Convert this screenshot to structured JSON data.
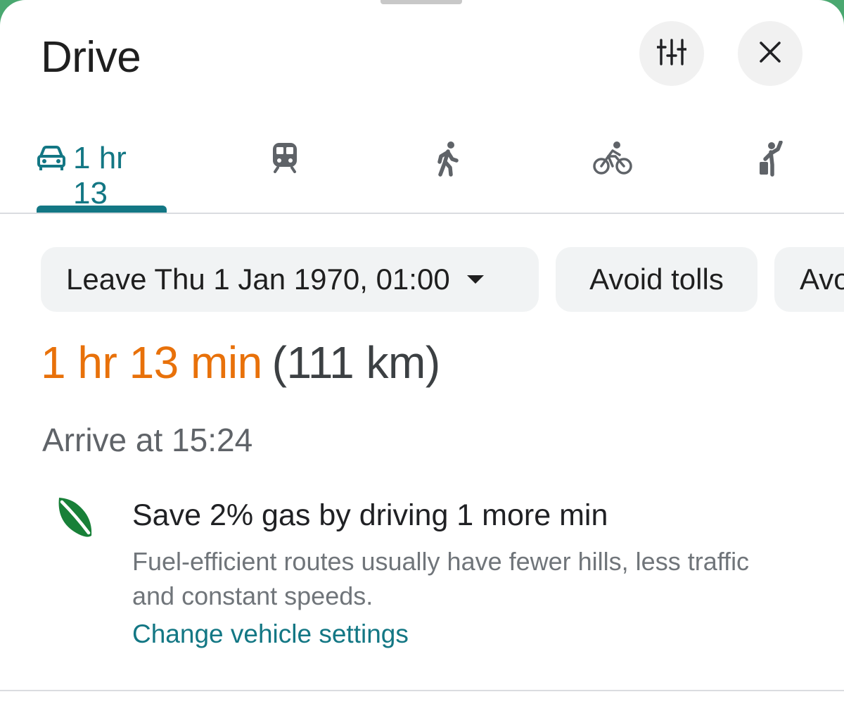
{
  "header": {
    "title": "Drive",
    "tune_icon": "tune-sliders-icon",
    "close_icon": "close-icon"
  },
  "tabs": [
    {
      "mode": "drive",
      "icon": "car-icon",
      "label": "1 hr 13",
      "selected": true
    },
    {
      "mode": "transit",
      "icon": "train-icon",
      "label": ""
    },
    {
      "mode": "walk",
      "icon": "walking-icon",
      "label": ""
    },
    {
      "mode": "cycle",
      "icon": "bicycle-icon",
      "label": ""
    },
    {
      "mode": "ride",
      "icon": "ride-hailing-icon",
      "label": ""
    }
  ],
  "chips": {
    "leave": "Leave Thu 1 Jan 1970, 01:00",
    "avoid_tolls": "Avoid tolls",
    "avoid_more": "Avo"
  },
  "route": {
    "duration": "1 hr 13 min",
    "distance": "(111 km)",
    "arrive": "Arrive at 15:24"
  },
  "eco": {
    "icon": "leaf-icon",
    "title": "Save 2% gas by driving 1 more min",
    "description": "Fuel-efficient routes usually have fewer hills, less traffic and constant speeds.",
    "link": "Change vehicle settings"
  },
  "colors": {
    "accent": "#137784",
    "duration": "#e8710a",
    "leaf": "#188038"
  }
}
